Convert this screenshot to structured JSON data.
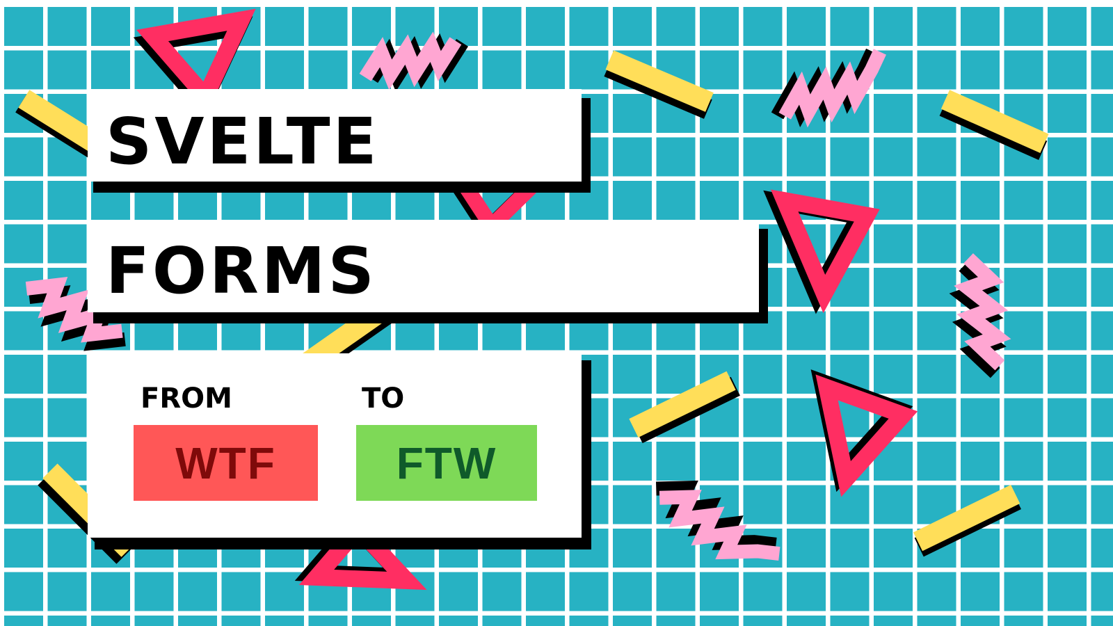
{
  "title_line_1": "SVELTE",
  "title_line_2": "FORMS",
  "comparison": {
    "from_label": "FROM",
    "to_label": "TO",
    "from_value": "WTF",
    "to_value": "FTW"
  },
  "colors": {
    "grid_background": "#27b2c3",
    "grid_lines": "#ffffff",
    "card": "#ffffff",
    "card_shadow": "#000000",
    "wtf_badge": "#ff5757",
    "wtf_text": "#7f0a0a",
    "ftw_badge": "#7ed957",
    "ftw_text": "#0f5a2a",
    "confetti_yellow": "#ffde59",
    "confetti_pink": "#ffa6d2",
    "confetti_red": "#ff2e62"
  }
}
